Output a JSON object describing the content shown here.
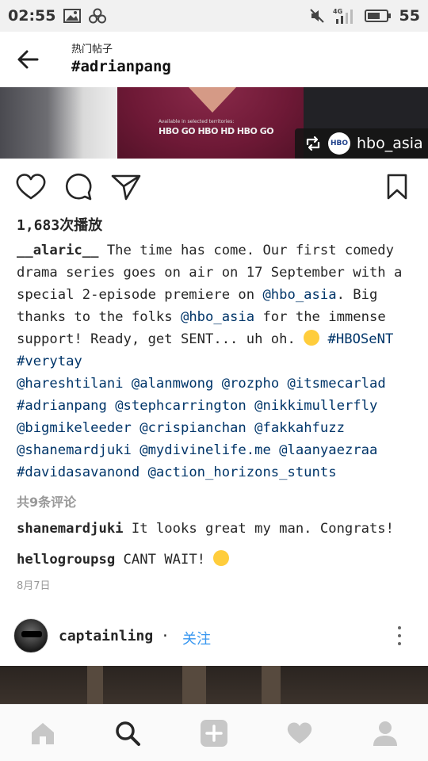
{
  "status_bar": {
    "time": "02:55",
    "network": "4G",
    "battery": "55"
  },
  "header": {
    "subtitle": "热门帖子",
    "title": "#adrianpang",
    "back_icon": "arrow-left-icon"
  },
  "photo": {
    "available_text": "Available in selected territories:",
    "brands": "HBO GO  HBO HD  HBO GO",
    "repost_badge": "HBO",
    "repost_user": "hbo_asia"
  },
  "actions": {
    "like_icon": "heart-icon",
    "comment_icon": "comment-icon",
    "share_icon": "send-icon",
    "save_icon": "bookmark-icon"
  },
  "plays": {
    "count": "1,683",
    "label": "次播放"
  },
  "caption": {
    "username": "__alaric__",
    "l1": " The time has come. Our first comedy",
    "l2": "drama series goes on air on 17 September with a",
    "l3a": "special 2-episode premiere on ",
    "m1": "@hbo_asia",
    "l3b": ". Big",
    "l4a": "thanks to the folks ",
    "m2": "@hbo_asia",
    "l4b": " for the immense",
    "l5a": "support! Ready, get SENT... uh oh. ",
    "t1": "#HBOSeNT",
    "t2": "#verytay",
    "m3": "@hareshtilani",
    "m4": "@alanmwong",
    "m5": "@rozpho",
    "m6": "@itsmecarlad",
    "t3": "#adrianpang",
    "m7": "@stephcarrington",
    "m8": "@nikkimullerfly",
    "m9": "@bigmikeleeder",
    "m10": "@crispianchan",
    "m11": "@fakkahfuzz",
    "m12": "@shanemardjuki",
    "m13": "@mydivinelife.me",
    "m14": "@laanyaezraa",
    "t4": "#davidasavanond",
    "m15": "@action_horizons_stunts"
  },
  "comments": {
    "count_label": "共9条评论",
    "items": [
      {
        "username": "shanemardjuki",
        "text": " It looks great my man. Congrats!"
      },
      {
        "username": "hellogroupsg",
        "text": " CANT WAIT! "
      }
    ],
    "date": "8月7日"
  },
  "next_post": {
    "username": "captainling",
    "separator": "·",
    "follow_label": "关注"
  },
  "tabbar": {
    "home_icon": "home-icon",
    "search_icon": "search-icon",
    "add_icon": "add-icon",
    "activity_icon": "heart-icon",
    "profile_icon": "profile-icon"
  },
  "colors": {
    "link": "#003569",
    "follow": "#3897f0",
    "muted": "#999999",
    "text": "#262626"
  }
}
